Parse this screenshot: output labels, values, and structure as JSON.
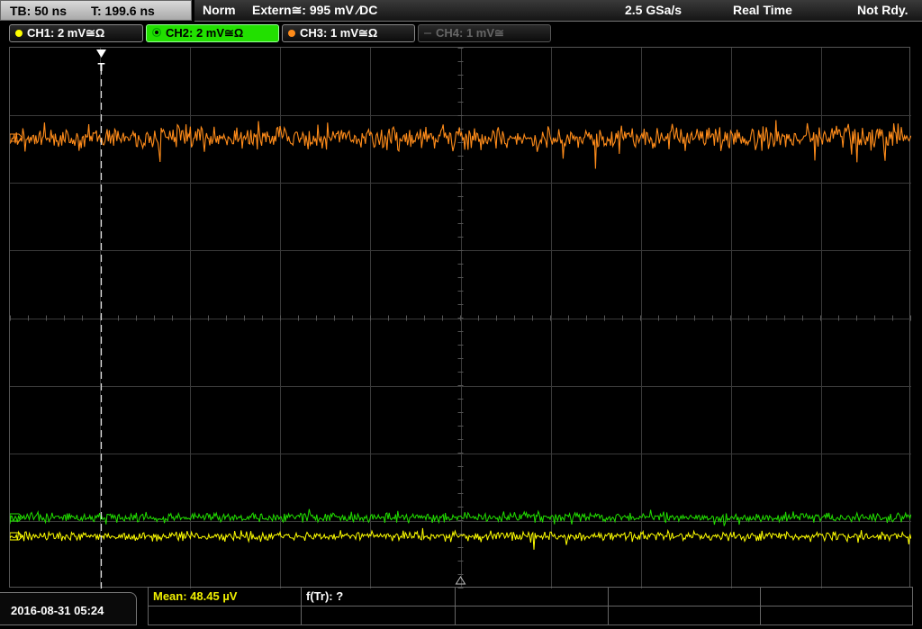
{
  "topbar": {
    "timebase": "TB: 50 ns",
    "trigger_time": "T: 199.6 ns",
    "mode": "Norm",
    "trigger_source": "Extern≅: 995 mV ⁄DC",
    "sample_rate": "2.5 GSa/s",
    "acq_mode": "Real Time",
    "status": "Not Rdy."
  },
  "channels": [
    {
      "label": "CH1: 2 mV≅Ω",
      "color": "#ffff00",
      "state": "on"
    },
    {
      "label": "CH2: 2 mV≅Ω",
      "color": "#22e000",
      "state": "active"
    },
    {
      "label": "CH3: 1 mV≅Ω",
      "color": "#ff8c1a",
      "state": "on"
    },
    {
      "label": "CH4: 1 mV≅",
      "color": "#666666",
      "state": "off"
    }
  ],
  "screen": {
    "trigger_marker": "T"
  },
  "footer": {
    "datetime": "2016-08-31 05:24",
    "mean": "Mean: 48.45 µV",
    "f_tr": "f(Tr): ?"
  }
}
